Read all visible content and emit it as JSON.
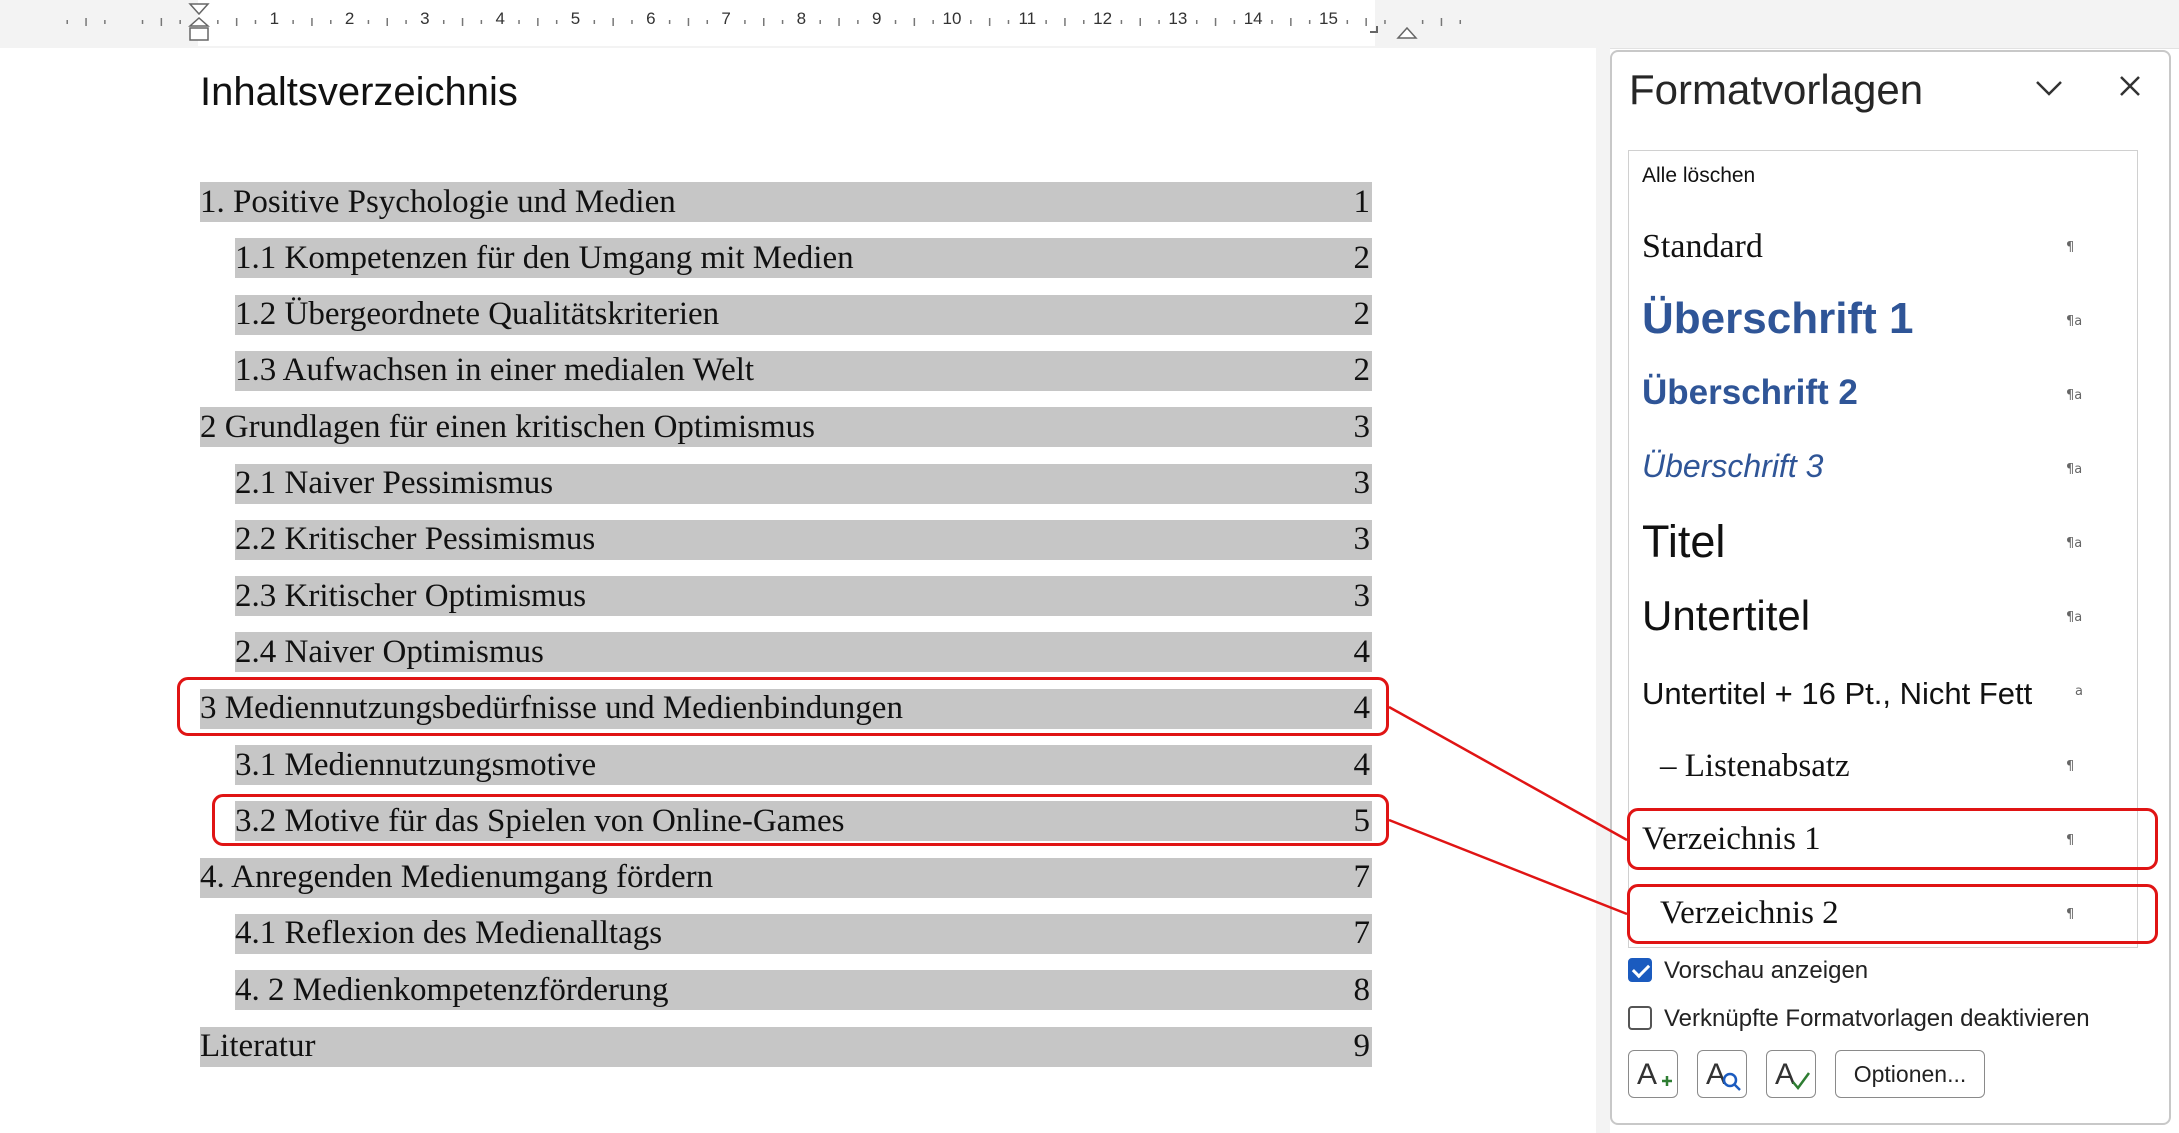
{
  "ruler": {
    "numbers": [
      "1",
      "2",
      "3",
      "4",
      "5",
      "6",
      "7",
      "8",
      "9",
      "10",
      "11",
      "12",
      "13",
      "14",
      "15"
    ]
  },
  "document": {
    "heading": "Inhaltsverzeichnis",
    "toc": [
      {
        "text": "1. Positive Psychologie und Medien",
        "page": "1",
        "level": 1
      },
      {
        "text": "1.1 Kompetenzen für den Umgang mit Medien",
        "page": "2",
        "level": 2
      },
      {
        "text": "1.2 Übergeordnete Qualitätskriterien",
        "page": "2",
        "level": 2
      },
      {
        "text": "1.3 Aufwachsen in einer medialen Welt",
        "page": "2",
        "level": 2
      },
      {
        "text": "2 Grundlagen für einen kritischen Optimismus",
        "page": "3",
        "level": 1
      },
      {
        "text": "2.1 Naiver Pessimismus",
        "page": "3",
        "level": 2
      },
      {
        "text": "2.2 Kritischer Pessimismus",
        "page": "3",
        "level": 2
      },
      {
        "text": "2.3 Kritischer Optimismus",
        "page": "3",
        "level": 2
      },
      {
        "text": "2.4 Naiver Optimismus",
        "page": "4",
        "level": 2
      },
      {
        "text": "3 Mediennutzungsbedürfnisse und Medienbindungen",
        "page": "4",
        "level": 1,
        "highlighted": true
      },
      {
        "text": "3.1 Mediennutzungsmotive",
        "page": "4",
        "level": 2
      },
      {
        "text": "3.2 Motive für das Spielen von Online-Games",
        "page": "5",
        "level": 2,
        "highlighted": true
      },
      {
        "text": "4. Anregenden Medienumgang fördern",
        "page": "7",
        "level": 1
      },
      {
        "text": "4.1 Reflexion des Medienalltags",
        "page": "7",
        "level": 2
      },
      {
        "text": "4. 2 Medienkompetenzförderung",
        "page": "8",
        "level": 2
      },
      {
        "text": "Literatur",
        "page": "9",
        "level": 1
      }
    ]
  },
  "pane": {
    "title": "Formatvorlagen",
    "clear_all": "Alle löschen",
    "styles": [
      {
        "name": "Standard",
        "mark": "¶"
      },
      {
        "name": "Überschrift 1",
        "mark": "¶a"
      },
      {
        "name": "Überschrift 2",
        "mark": "¶a"
      },
      {
        "name": "Überschrift 3",
        "mark": "¶a"
      },
      {
        "name": "Titel",
        "mark": "¶a"
      },
      {
        "name": "Untertitel",
        "mark": "¶a"
      },
      {
        "name": "Untertitel + 16 Pt., Nicht Fett",
        "mark": "a"
      },
      {
        "name": "–  Listenabsatz",
        "mark": "¶"
      },
      {
        "name": "Verzeichnis 1",
        "mark": "¶",
        "highlighted": true
      },
      {
        "name": "Verzeichnis 2",
        "mark": "¶",
        "highlighted": true
      }
    ],
    "preview_label": "Vorschau anzeigen",
    "preview_checked": true,
    "linked_label": "Verknüpfte Formatvorlagen deaktivieren",
    "linked_checked": false,
    "options_label": "Optionen...",
    "colors": {
      "heading_blue": "#2f5597",
      "highlight_red": "#e01414",
      "toc_bg": "#c6c6c6"
    }
  }
}
